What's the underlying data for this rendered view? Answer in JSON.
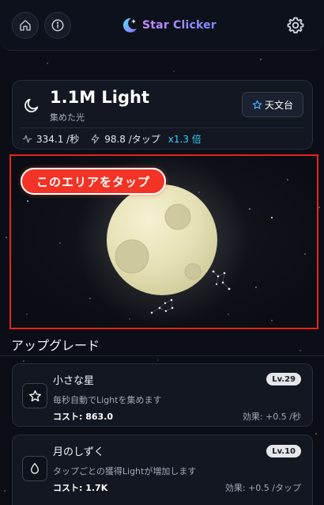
{
  "header": {
    "app_name": "Star Clicker",
    "home_icon": "home-icon",
    "info_icon": "info-icon",
    "settings_icon": "gear-icon"
  },
  "light": {
    "value": "1.1M Light",
    "caption": "集めた光",
    "observatory_label": "天文台",
    "per_second": "334.1 /秒",
    "per_tap": "98.8 /タップ",
    "multiplier": "x1.3 倍"
  },
  "tap_area": {
    "label": "このエリアをタップ"
  },
  "upgrades": {
    "title": "アップグレード",
    "items": [
      {
        "name": "小さな星",
        "level": "Lv.29",
        "description": "毎秒自動でLightを集めます",
        "cost": "コスト: 863.0",
        "effect": "効果: +0.5 /秒",
        "icon": "star-icon"
      },
      {
        "name": "月のしずく",
        "level": "Lv.10",
        "description": "タップごとの獲得Lightが増加します",
        "cost": "コスト: 1.7K",
        "effect": "効果: +0.5 /タップ",
        "icon": "drop-icon"
      }
    ]
  },
  "colors": {
    "background": "#0b0e16",
    "accent": "#31d3ff",
    "tap_label": "#f23325",
    "highlight_border": "#e8231a"
  }
}
